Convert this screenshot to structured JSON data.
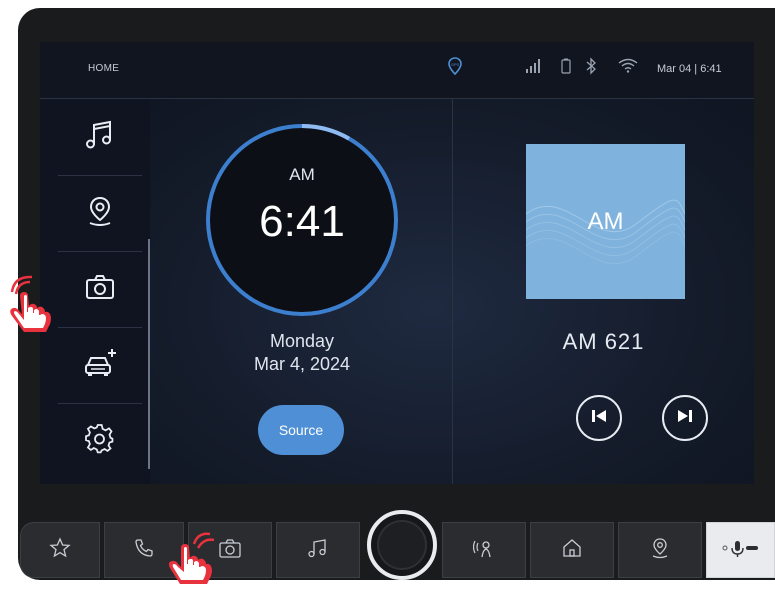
{
  "status_bar": {
    "title": "HOME",
    "datetime": "Mar 04 | 6:41",
    "gps_badge": "GPS"
  },
  "sidebar": {
    "items": [
      {
        "icon": "music-note-icon"
      },
      {
        "icon": "location-pin-icon"
      },
      {
        "icon": "camera-icon"
      },
      {
        "icon": "car-add-icon"
      },
      {
        "icon": "gear-icon"
      }
    ]
  },
  "clock": {
    "ampm": "AM",
    "time": "6:41",
    "day": "Monday",
    "date": "Mar 4, 2024",
    "source_label": "Source"
  },
  "media": {
    "album_label": "AM",
    "station": "AM  621",
    "prev_icon": "skip-previous-icon",
    "next_icon": "skip-next-icon"
  },
  "hard_buttons": [
    {
      "icon": "star-icon"
    },
    {
      "icon": "phone-icon"
    },
    {
      "icon": "camera-icon"
    },
    {
      "icon": "music-note-icon"
    },
    {
      "icon": "voice-icon"
    },
    {
      "icon": "home-icon"
    },
    {
      "icon": "location-pin-icon"
    },
    {
      "icon": "microphone-icon"
    }
  ],
  "colors": {
    "accent": "#4f8fd6",
    "album_bg": "#7fb3dd",
    "hand": "#e8323e"
  }
}
